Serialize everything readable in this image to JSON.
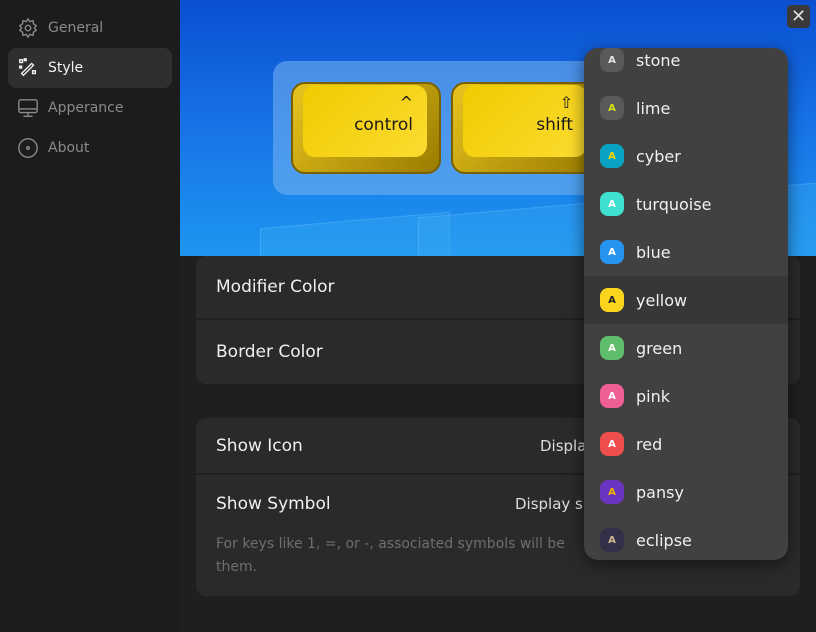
{
  "sidebar": {
    "items": [
      {
        "label": "General",
        "icon": "gear-icon"
      },
      {
        "label": "Style",
        "icon": "magic-wand-icon",
        "active": true
      },
      {
        "label": "Apperance",
        "icon": "monitor-icon"
      },
      {
        "label": "About",
        "icon": "info-circle-icon"
      }
    ]
  },
  "preview": {
    "keys": [
      {
        "symbol": "^",
        "label": "control"
      },
      {
        "symbol": "⇧",
        "label": "shift"
      }
    ],
    "close_label": "✕"
  },
  "settings": {
    "modifier_color": "Modifier Color",
    "border_color": "Border Color",
    "show_icon": "Show Icon",
    "show_icon_value": "Displa",
    "show_symbol": "Show Symbol",
    "show_symbol_value": "Display s",
    "symbol_desc": "For keys like 1, =, or -, associated symbols will be",
    "symbol_desc_2": "them."
  },
  "dropdown": {
    "selected": "yellow",
    "options": [
      {
        "label": "stone",
        "bg": "#5a5a5a",
        "fg": "#e6e6e6"
      },
      {
        "label": "lime",
        "bg": "#5a5a5a",
        "fg": "#d6e21a"
      },
      {
        "label": "cyber",
        "bg": "#0aa3c4",
        "fg": "#f2d800"
      },
      {
        "label": "turquoise",
        "bg": "#3fe0d0",
        "fg": "#ffffff"
      },
      {
        "label": "blue",
        "bg": "#2794f0",
        "fg": "#ffffff"
      },
      {
        "label": "yellow",
        "bg": "#fbd420",
        "fg": "#222222"
      },
      {
        "label": "green",
        "bg": "#5ebc6a",
        "fg": "#ffffff"
      },
      {
        "label": "pink",
        "bg": "#ee5f95",
        "fg": "#ffffff"
      },
      {
        "label": "red",
        "bg": "#ee4e4e",
        "fg": "#ffffff"
      },
      {
        "label": "pansy",
        "bg": "#6a35c0",
        "fg": "#f0b800"
      },
      {
        "label": "eclipse",
        "bg": "#33304a",
        "fg": "#d4b890"
      }
    ]
  }
}
